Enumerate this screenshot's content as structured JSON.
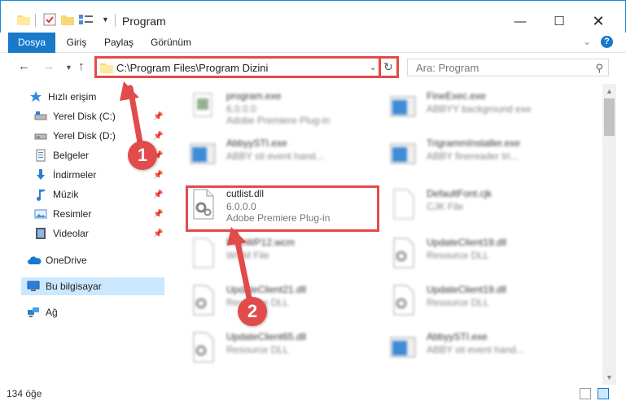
{
  "window": {
    "title": "Program",
    "minimize": "—",
    "maximize": "☐",
    "close": "✕"
  },
  "ribbon": {
    "tabs": [
      "Dosya",
      "Giriş",
      "Paylaş",
      "Görünüm"
    ],
    "help": "?"
  },
  "nav": {
    "address": "C:\\Program Files\\Program Dizini",
    "search_placeholder": "Ara: Program"
  },
  "sidebar": {
    "quick_access": "Hızlı erişim",
    "items": [
      {
        "label": "Yerel Disk (C:)",
        "icon": "drive-icon",
        "pinned": true
      },
      {
        "label": "Yerel Disk (D:)",
        "icon": "drive-icon",
        "pinned": true
      },
      {
        "label": "Belgeler",
        "icon": "documents-icon",
        "pinned": true
      },
      {
        "label": "İndirmeler",
        "icon": "download-icon",
        "pinned": true
      },
      {
        "label": "Müzik",
        "icon": "music-icon",
        "pinned": true
      },
      {
        "label": "Resimler",
        "icon": "pictures-icon",
        "pinned": true
      },
      {
        "label": "Videolar",
        "icon": "videos-icon",
        "pinned": true
      }
    ],
    "onedrive": "OneDrive",
    "this_pc": "Bu bilgisayar",
    "network": "Ağ"
  },
  "files": [
    {
      "name": "program.exe",
      "line2": "6.0.0.0",
      "line3": "Adobe Premiere Plug-in",
      "blurred": true
    },
    {
      "name": "FineExec.exe",
      "line2": "ABBYY background exe",
      "line3": "",
      "blurred": true
    },
    {
      "name": "AbbyySTI.exe",
      "line2": "ABBY sti event hand...",
      "line3": "",
      "blurred": true
    },
    {
      "name": "TrigrammInstaller.exe",
      "line2": "ABBY finereader tri...",
      "line3": "",
      "blurred": true
    },
    {
      "name": "cutlist.dll",
      "line2": "6.0.0.0",
      "line3": "Adobe Premiere Plug-in",
      "blurred": false
    },
    {
      "name": "DefaultFont.cjk",
      "line2": "CJK File",
      "line3": "",
      "blurred": true
    },
    {
      "name": "FineWP12.wcm",
      "line2": "WCM File",
      "line3": "",
      "blurred": true
    },
    {
      "name": "UpdateClient19.dll",
      "line2": "Resource DLL",
      "line3": "",
      "blurred": true
    },
    {
      "name": "UpdateClient21.dll",
      "line2": "Resource DLL",
      "line3": "",
      "blurred": true
    },
    {
      "name": "UpdateClient19.dll",
      "line2": "Resource DLL",
      "line3": "",
      "blurred": true
    },
    {
      "name": "UpdateClient65.dll",
      "line2": "Resource DLL",
      "line3": "",
      "blurred": true
    },
    {
      "name": "AbbyySTI.exe",
      "line2": "ABBY sti event hand...",
      "line3": "",
      "blurred": true
    }
  ],
  "status": {
    "item_count": "134 öğe"
  },
  "annotations": {
    "step1": "1",
    "step2": "2",
    "color": "#e24b4b"
  }
}
